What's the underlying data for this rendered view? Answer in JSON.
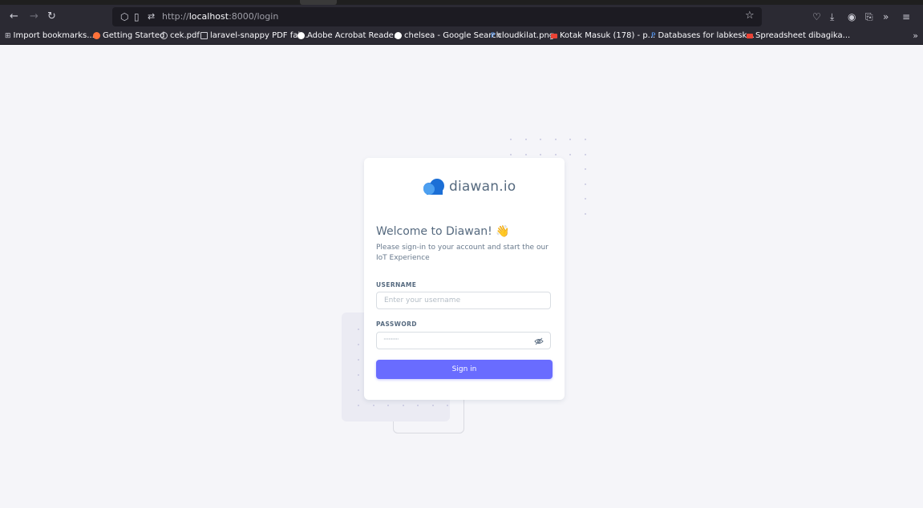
{
  "browser": {
    "url_scheme": "http://",
    "url_host": "localhost",
    "url_path": ":8000/login",
    "bookmarks": [
      {
        "label": "Import bookmarks...",
        "icon": "import-icon",
        "color": "#cfcfd8"
      },
      {
        "label": "Getting Started",
        "icon": "firefox-icon",
        "color": "#ff7139"
      },
      {
        "label": "cek.pdf",
        "icon": "globe-icon",
        "color": "#cfcfd8"
      },
      {
        "label": "laravel-snappy PDF fai...",
        "icon": "page-icon",
        "color": "#cfcfd8"
      },
      {
        "label": "Adobe Acrobat Reade...",
        "icon": "google-icon",
        "color": "#ffffff"
      },
      {
        "label": "chelsea - Google Search",
        "icon": "google-icon",
        "color": "#ffffff"
      },
      {
        "label": "cloudkilat.png",
        "icon": "p-icon",
        "color": "#5aa0ff"
      },
      {
        "label": "Kotak Masuk (178) - p...",
        "icon": "gmail-icon",
        "color": "#ea4335"
      },
      {
        "label": "Databases for labkesk...",
        "icon": "p-icon",
        "color": "#5aa0ff"
      },
      {
        "label": "Spreadsheet dibagika...",
        "icon": "gmail-icon",
        "color": "#ea4335"
      }
    ]
  },
  "login": {
    "brand": "diawan.io",
    "welcome": "Welcome to Diawan!",
    "wave": "👋",
    "subtitle": "Please sign-in to your account and start the our IoT Experience",
    "username_label": "USERNAME",
    "username_placeholder": "Enter your username",
    "password_label": "PASSWORD",
    "password_value": "············",
    "signin_label": "Sign in"
  },
  "colors": {
    "primary": "#696cff",
    "heading": "#566a7f",
    "body": "#697a8d",
    "cloud": "#3d8fea"
  }
}
